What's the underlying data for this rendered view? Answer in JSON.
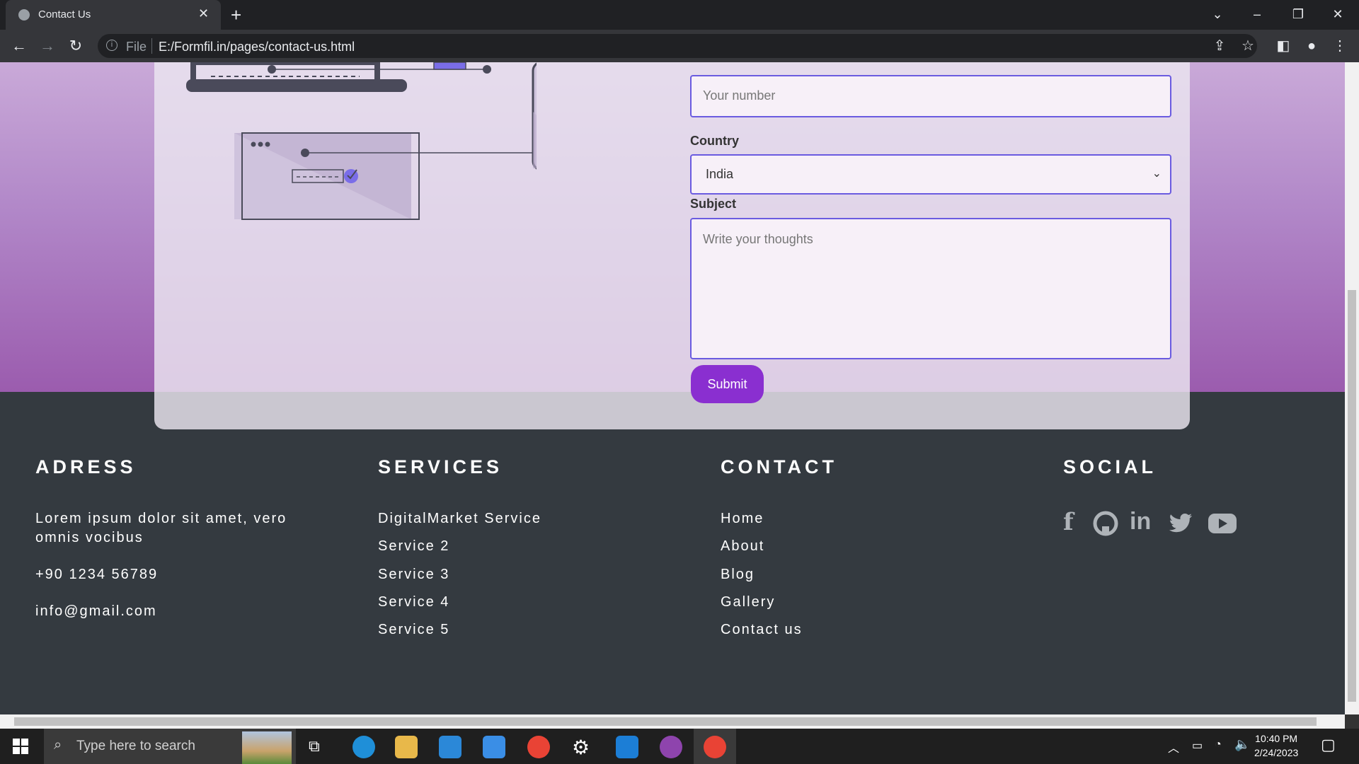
{
  "browser": {
    "tab_title": "Contact Us",
    "file_label": "File",
    "url": "E:/Formfil.in/pages/contact-us.html"
  },
  "form": {
    "phone_placeholder": "Your number",
    "country_label": "Country",
    "country_value": "India",
    "subject_label": "Subject",
    "subject_placeholder": "Write your thoughts",
    "submit_label": "Submit"
  },
  "footer": {
    "address": {
      "heading": "ADRESS",
      "text": "Lorem ipsum dolor sit amet, vero omnis vocibus",
      "phone": "+90 1234 56789",
      "email": "info@gmail.com"
    },
    "services": {
      "heading": "SERVICES",
      "items": [
        "DigitalMarket Service",
        "Service 2",
        "Service 3",
        "Service 4",
        "Service 5"
      ]
    },
    "contact": {
      "heading": "CONTACT",
      "items": [
        "Home",
        "About",
        "Blog",
        "Gallery",
        "Contact us"
      ]
    },
    "social": {
      "heading": "SOCIAL",
      "icons": [
        "facebook-icon",
        "github-icon",
        "linkedin-icon",
        "twitter-icon",
        "youtube-icon"
      ]
    }
  },
  "taskbar": {
    "search_placeholder": "Type here to search",
    "time": "10:40 PM",
    "date": "2/24/2023"
  },
  "colors": {
    "accent": "#6a5be0",
    "submit": "#8a2fd0",
    "footer_bg": "#343a40"
  }
}
